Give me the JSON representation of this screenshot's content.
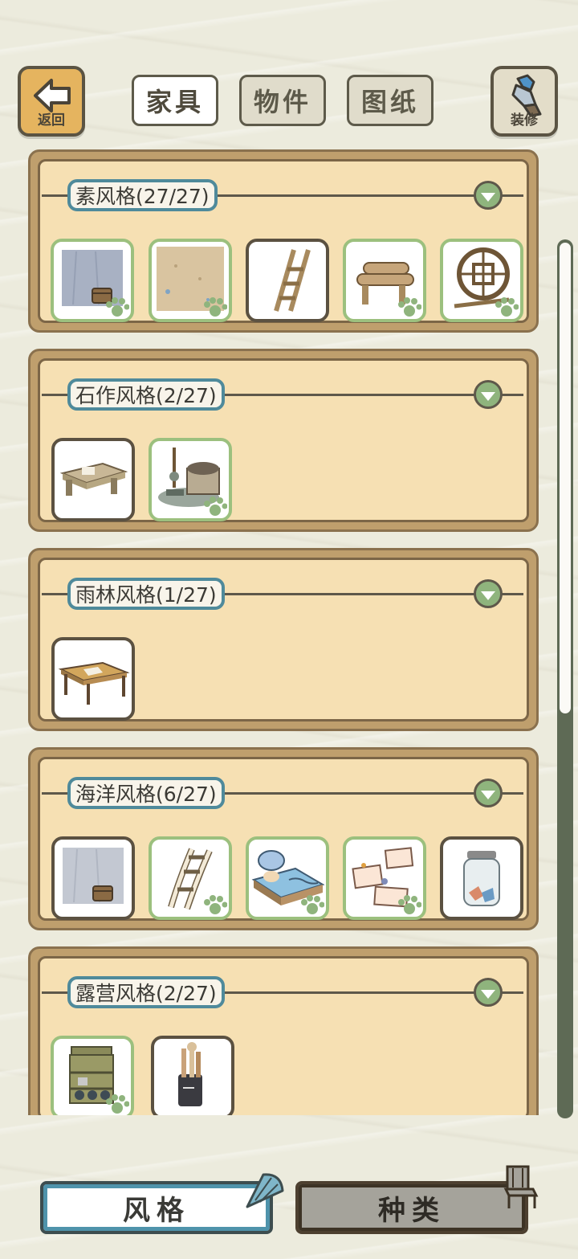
{
  "header": {
    "back_label": "返回",
    "decor_label": "装修",
    "tabs": [
      {
        "label": "家具",
        "active": true
      },
      {
        "label": "物件",
        "active": false
      },
      {
        "label": "图纸",
        "active": false
      }
    ]
  },
  "categories": [
    {
      "title": "素风格(27/27)",
      "items": [
        {
          "name": "wall-with-bucket",
          "owned": true
        },
        {
          "name": "sand-floor",
          "owned": true
        },
        {
          "name": "wooden-ladder",
          "owned": false
        },
        {
          "name": "log-bench",
          "owned": true
        },
        {
          "name": "round-lattice-window",
          "owned": true
        }
      ]
    },
    {
      "title": "石作风格(2/27)",
      "items": [
        {
          "name": "stone-table",
          "owned": false
        },
        {
          "name": "stone-stove",
          "owned": true
        }
      ]
    },
    {
      "title": "雨林风格(1/27)",
      "items": [
        {
          "name": "wooden-low-table",
          "owned": false
        }
      ]
    },
    {
      "title": "海洋风格(6/27)",
      "items": [
        {
          "name": "wall-with-bucket",
          "owned": false
        },
        {
          "name": "white-ladder",
          "owned": true
        },
        {
          "name": "ocean-bed",
          "owned": true
        },
        {
          "name": "notes-board",
          "owned": true
        },
        {
          "name": "glass-jar",
          "owned": false
        }
      ]
    },
    {
      "title": "露营风格(2/27)",
      "items": [
        {
          "name": "camping-shelf",
          "owned": true
        },
        {
          "name": "tool-bucket",
          "owned": false
        }
      ]
    }
  ],
  "footer": {
    "style_label": "风格",
    "kind_label": "种类"
  },
  "colors": {
    "owned_border": "#9cc07e",
    "accent_blue": "#4f8a9b",
    "panel_fill": "#f6e0b3"
  }
}
